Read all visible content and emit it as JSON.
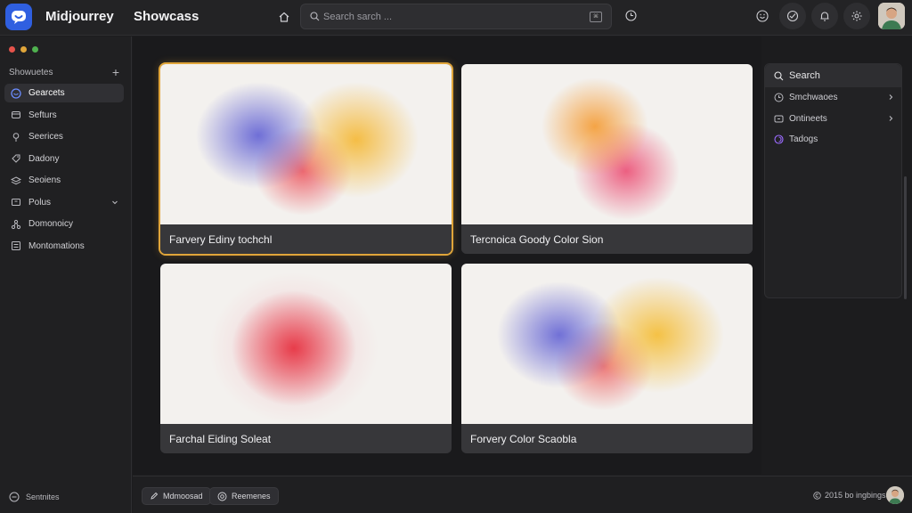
{
  "app": {
    "title": "Midjourrey",
    "page_title": "Showcass"
  },
  "search": {
    "placeholder": "Search sarch ..."
  },
  "sidebar": {
    "header": "Showuetes",
    "items": [
      {
        "label": "Gearcets",
        "icon": "chat-icon",
        "active": true
      },
      {
        "label": "Sefturs",
        "icon": "folder-icon"
      },
      {
        "label": "Seerices",
        "icon": "pin-icon"
      },
      {
        "label": "Dadony",
        "icon": "tag-icon"
      },
      {
        "label": "Seoiens",
        "icon": "layers-icon"
      },
      {
        "label": "Polus",
        "icon": "box-icon"
      },
      {
        "label": "Domonoicy",
        "icon": "share-icon"
      },
      {
        "label": "Montomations",
        "icon": "list-icon"
      }
    ],
    "footer": "Sentnites"
  },
  "cards": [
    {
      "caption": "Farvery Ediny tochchl",
      "selected": true
    },
    {
      "caption": "Tercnoica Goody Color Sion"
    },
    {
      "caption": "Farchal Eiding Soleat"
    },
    {
      "caption": "Forvery Color Scaobla"
    }
  ],
  "right_panel": {
    "search_label": "Search",
    "items": [
      {
        "label": "Smchwaoes",
        "icon": "clock-icon"
      },
      {
        "label": "Ontineets",
        "icon": "box-icon"
      },
      {
        "label": "Tadogs",
        "icon": "swirl-icon"
      }
    ]
  },
  "bottom": {
    "pill1": "Mdmoosad",
    "pill2": "Reemenes",
    "copyright": "2015 bo ingbings"
  },
  "colors": {
    "accent": "#e0a53a",
    "brand": "#2f5fe0",
    "background": "#1c1c1e"
  }
}
